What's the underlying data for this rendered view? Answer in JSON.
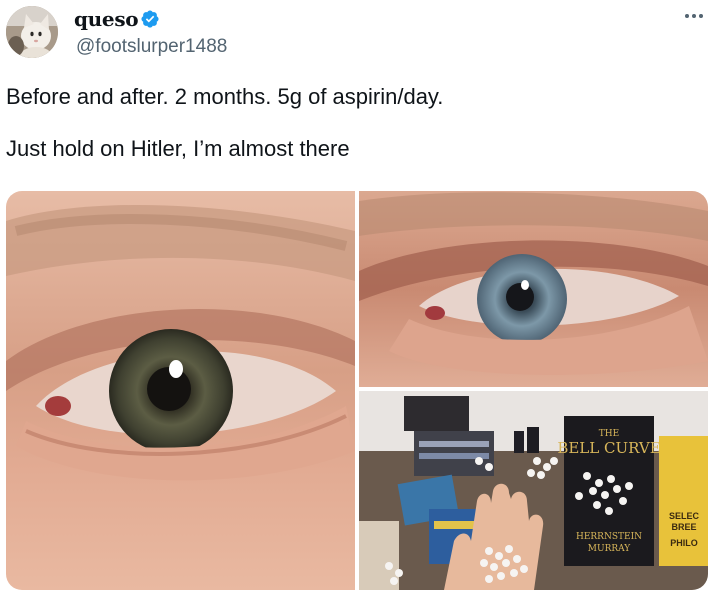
{
  "author": {
    "display_name": "queso",
    "handle": "@footslurper1488",
    "verified": true
  },
  "tweet": {
    "lines": [
      "Before and after. 2 months. 5g of aspirin/day.",
      "Just hold on Hitler, I’m almost there"
    ]
  },
  "media": {
    "book_title_fragment": "THE BELL CURVE",
    "book_author_fragment": "HERRNSTEIN MURRAY",
    "yellow_book_fragment": "SELEC BREE PHILO"
  },
  "colors": {
    "text": "#0f1419",
    "secondary_text": "#536471",
    "verified_badge": "#1d9bf0"
  },
  "icons": {
    "verified": "verified-badge-icon",
    "more": "more-options-icon"
  }
}
